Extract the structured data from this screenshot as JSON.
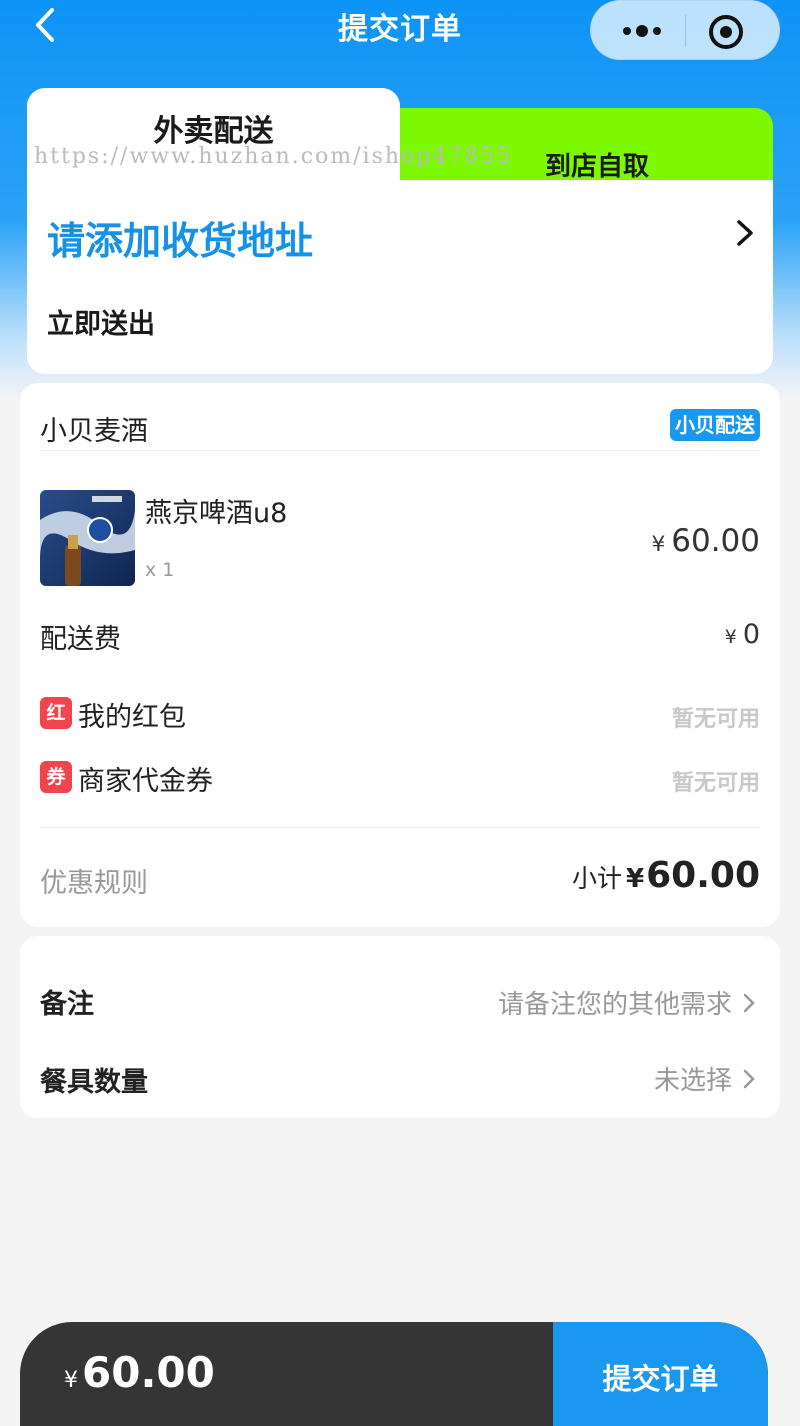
{
  "nav": {
    "title": "提交订单"
  },
  "delivery": {
    "tab_delivery": "外卖配送",
    "tab_pickup": "到店自取",
    "watermark": "https://www.huzhan.com/ishop47855",
    "address_prompt": "请添加收货地址",
    "send_time": "立即送出"
  },
  "order": {
    "shop_name": "小贝麦酒",
    "shop_badge": "小贝配送",
    "item": {
      "name": "燕京啤酒u8",
      "qty": "x 1",
      "currency": "¥",
      "price": "60.00"
    },
    "delivery_fee": {
      "label": "配送费",
      "currency": "¥",
      "value": "0"
    },
    "red_packet": {
      "badge": "红",
      "label": "我的红包",
      "value": "暂无可用"
    },
    "voucher": {
      "badge": "券",
      "label": "商家代金券",
      "value": "暂无可用"
    },
    "promo_rules": "优惠规则",
    "subtotal": {
      "label": "小计",
      "currency": "¥",
      "amount": "60.00"
    }
  },
  "extras": {
    "remark": {
      "label": "备注",
      "placeholder": "请备注您的其他需求"
    },
    "tableware": {
      "label": "餐具数量",
      "value": "未选择"
    }
  },
  "footer": {
    "currency": "¥",
    "total": "60.00",
    "submit_label": "提交订单"
  },
  "colors": {
    "primary": "#1a98f0",
    "pickup_tab": "#7cf800",
    "coupon_badge": "#f0454c",
    "footer_bg": "#353535"
  }
}
